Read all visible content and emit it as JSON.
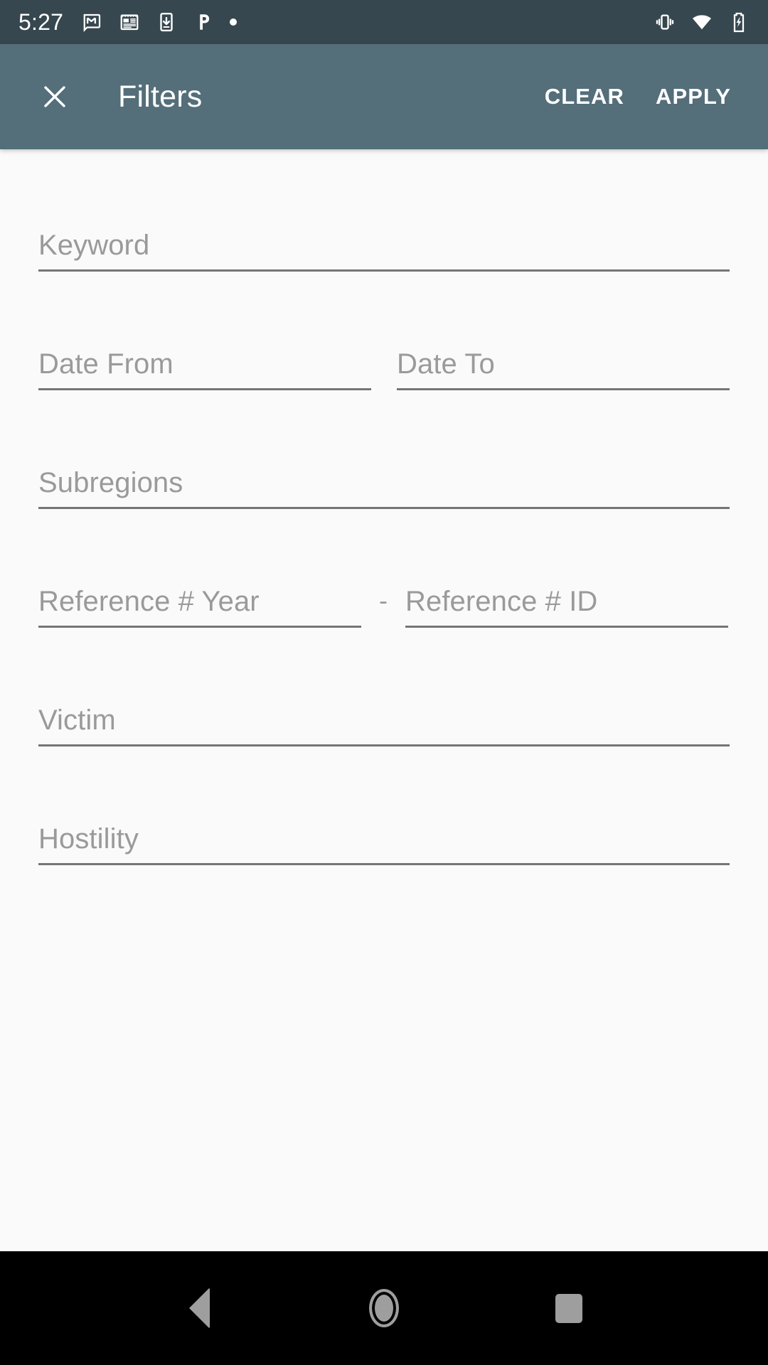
{
  "status_bar": {
    "time": "5:27",
    "left_icons": [
      {
        "name": "gmail-icon",
        "label": "Gmail"
      },
      {
        "name": "news-icon",
        "label": "News"
      },
      {
        "name": "phone-download-icon",
        "label": "Download"
      },
      {
        "name": "pandora-icon",
        "label": "Pandora"
      },
      {
        "name": "notification-dot-icon",
        "label": "More notifications"
      }
    ],
    "right_icons": [
      {
        "name": "vibrate-icon",
        "label": "Vibrate"
      },
      {
        "name": "wifi-icon",
        "label": "Wi-Fi"
      },
      {
        "name": "battery-charging-icon",
        "label": "Battery charging"
      }
    ],
    "background_color": "#37474F",
    "foreground_color": "#FFFFFF"
  },
  "app_bar": {
    "title": "Filters",
    "close_label": "Close",
    "clear_label": "CLEAR",
    "apply_label": "APPLY",
    "background_color": "#546E7A",
    "foreground_color": "#FFFFFF"
  },
  "form": {
    "keyword": {
      "placeholder": "Keyword",
      "value": ""
    },
    "date_from": {
      "placeholder": "Date From",
      "value": ""
    },
    "date_to": {
      "placeholder": "Date To",
      "value": ""
    },
    "subregions": {
      "placeholder": "Subregions",
      "value": ""
    },
    "reference_year": {
      "placeholder": "Reference # Year",
      "value": ""
    },
    "reference_separator": "-",
    "reference_id": {
      "placeholder": "Reference # ID",
      "value": ""
    },
    "victim": {
      "placeholder": "Victim",
      "value": ""
    },
    "hostility": {
      "placeholder": "Hostility",
      "value": ""
    },
    "background_color": "#FAFAFA",
    "placeholder_color": "#9A9A9A",
    "underline_color": "#757575"
  },
  "nav_bar": {
    "back_label": "Back",
    "home_label": "Home",
    "recents_label": "Recents",
    "background_color": "#000000",
    "icon_color": "#9E9E9E"
  }
}
